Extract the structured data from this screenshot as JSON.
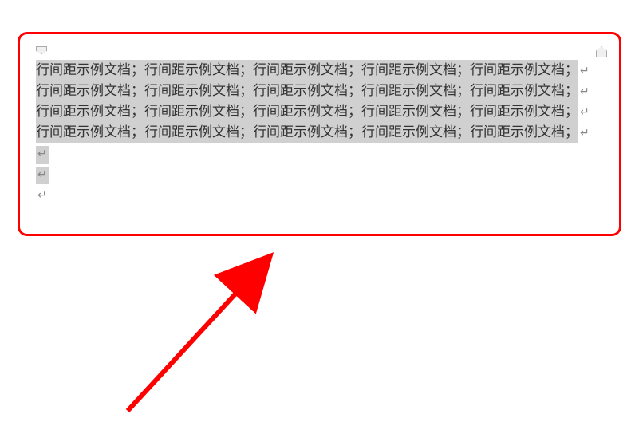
{
  "document": {
    "lines": [
      "行间距示例文档；行间距示例文档；行间距示例文档；行间距示例文档；行间距示例文档；",
      "行间距示例文档；行间距示例文档；行间距示例文档；行间距示例文档；行间距示例文档；",
      "行间距示例文档；行间距示例文档；行间距示例文档；行间距示例文档；行间距示例文档；",
      "行间距示例文档；行间距示例文档；行间距示例文档；行间距示例文档；行间距示例文档；"
    ],
    "paragraph_mark": "↵",
    "annotation": {
      "highlight_color": "#ff0000",
      "arrow_color": "#ff0000"
    }
  }
}
